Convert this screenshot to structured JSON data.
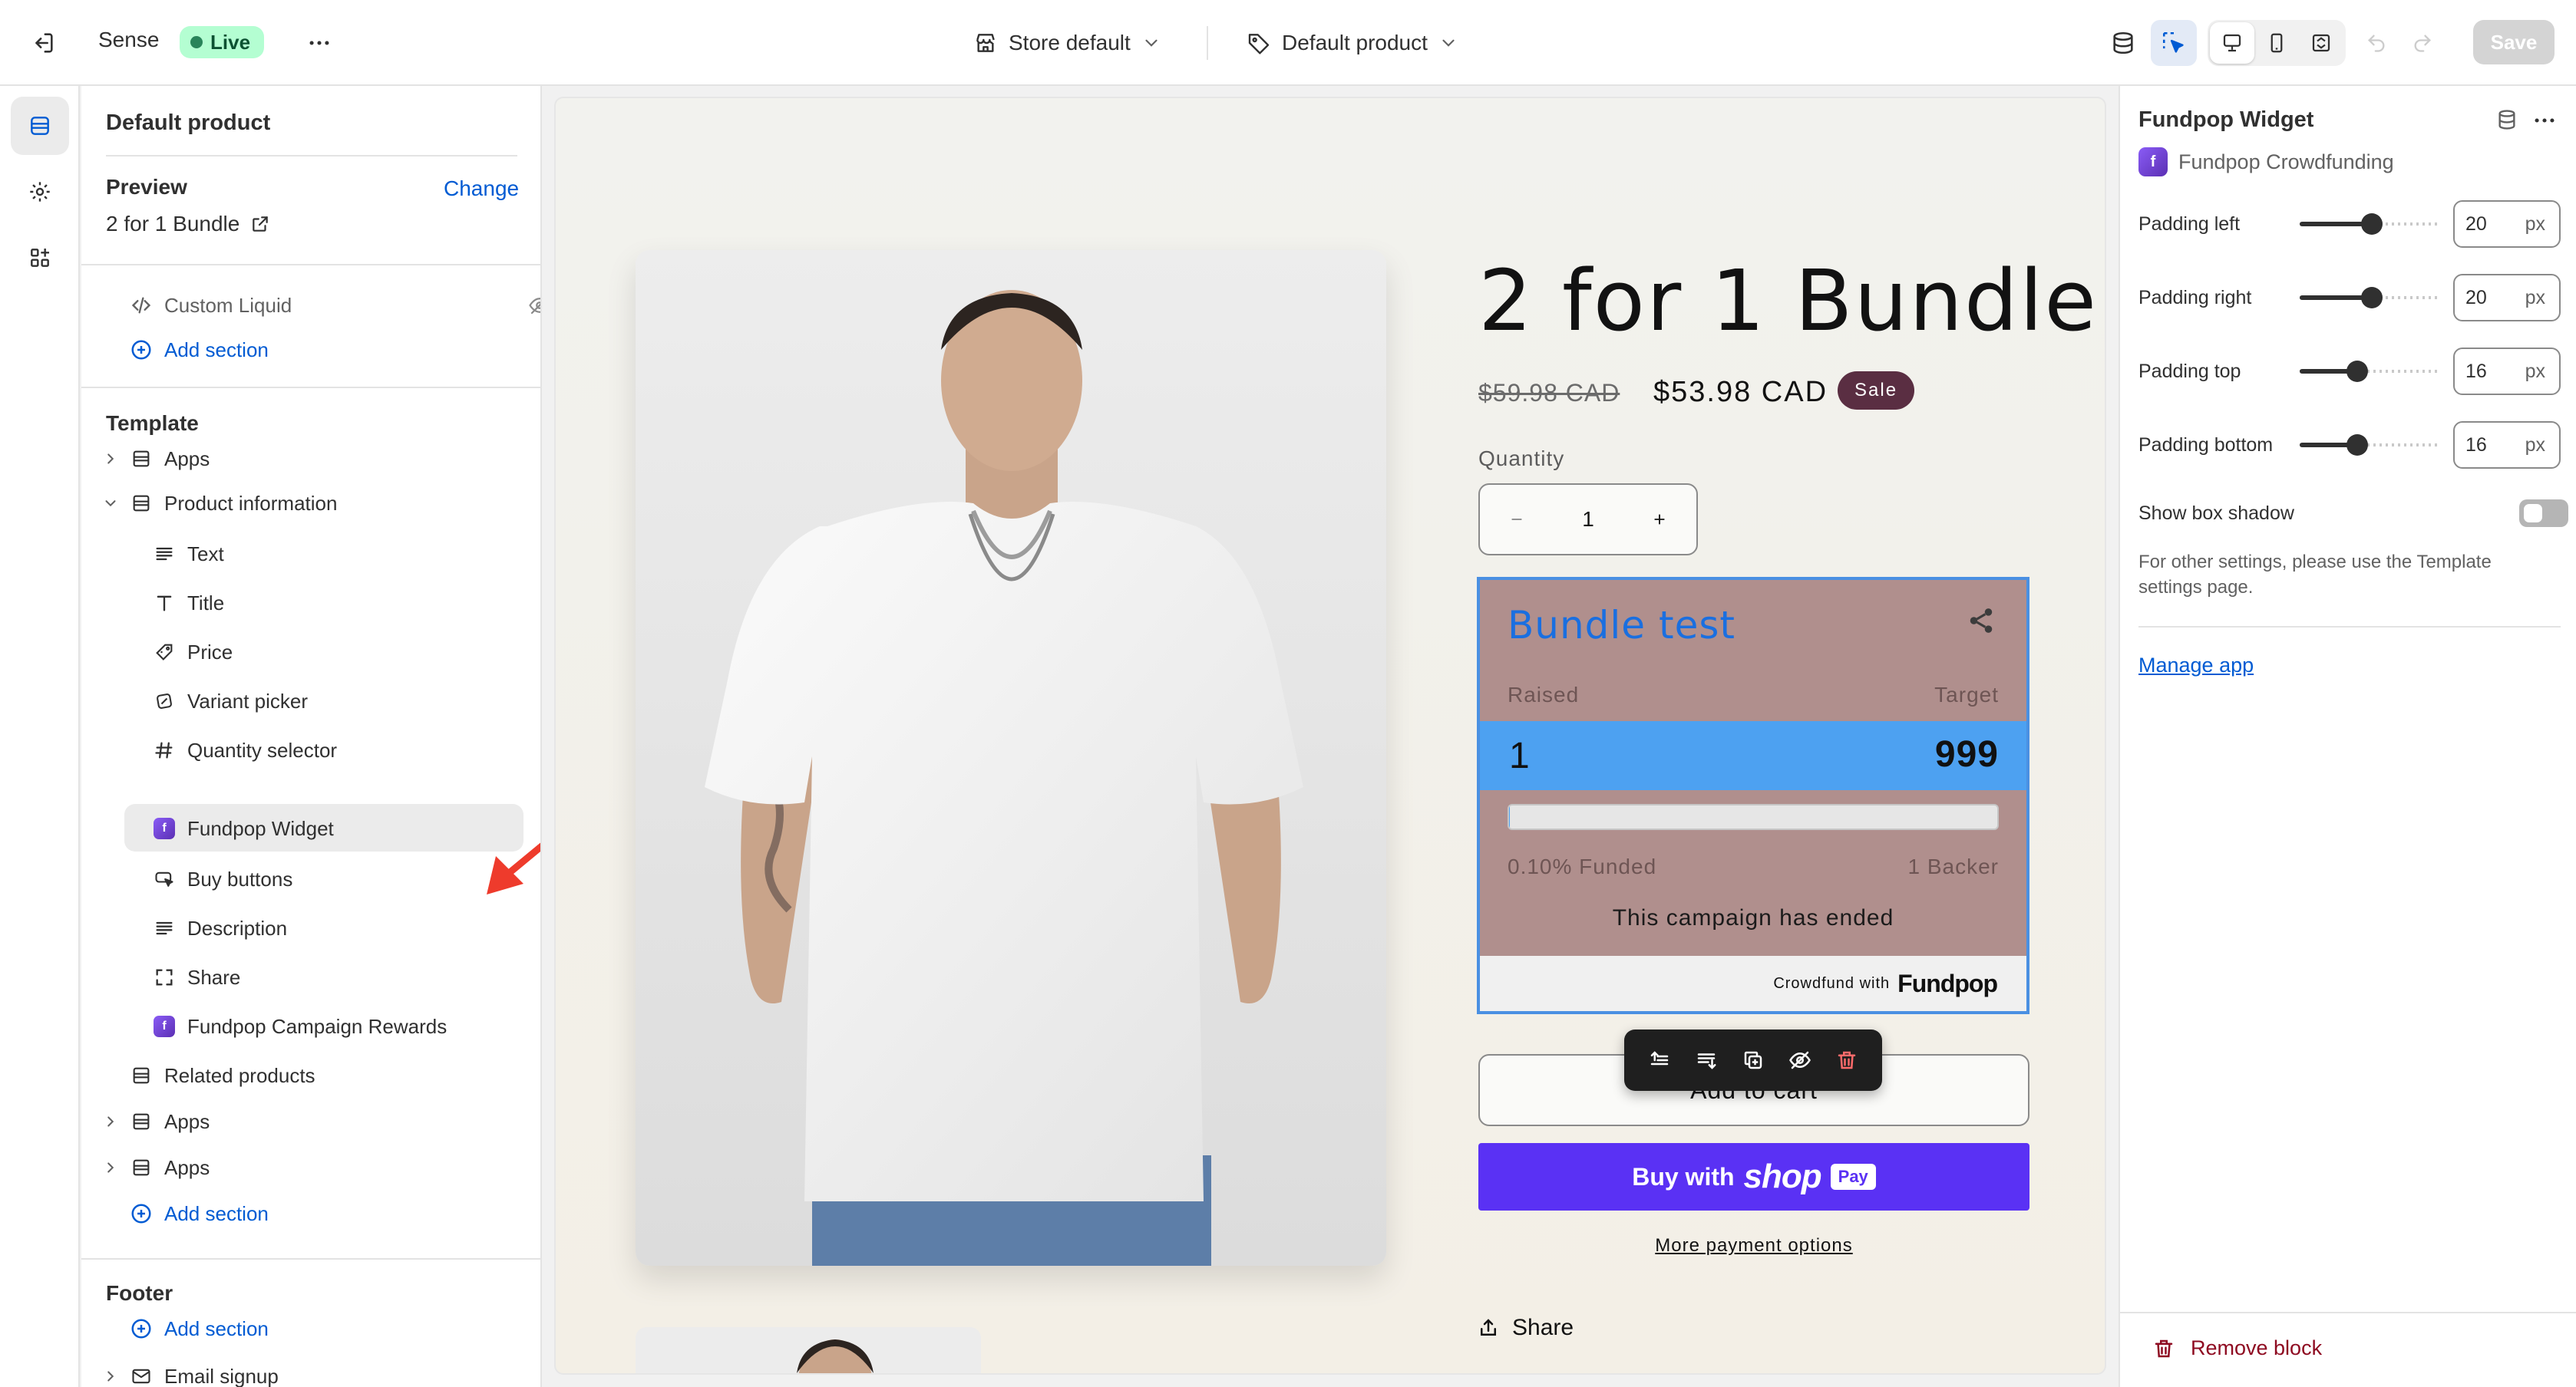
{
  "topbar": {
    "theme_name": "Sense",
    "live_label": "Live",
    "store_selector": "Store default",
    "template_selector": "Default product",
    "save_label": "Save"
  },
  "sidebar": {
    "title": "Default product",
    "preview": {
      "label": "Preview",
      "change_label": "Change",
      "value": "2 for 1 Bundle"
    },
    "header_items": {
      "custom_liquid": "Custom Liquid",
      "add_section": "Add section"
    },
    "template": {
      "label": "Template",
      "apps_1": "Apps",
      "product_information": "Product information",
      "blocks": [
        {
          "label": "Text",
          "icon": "text-icon"
        },
        {
          "label": "Title",
          "icon": "title-icon"
        },
        {
          "label": "Price",
          "icon": "price-tag-icon"
        },
        {
          "label": "Variant picker",
          "icon": "variant-picker-icon"
        },
        {
          "label": "Quantity selector",
          "icon": "hash-icon"
        },
        {
          "label": "Fundpop Widget",
          "icon": "fundpop-app-icon"
        },
        {
          "label": "Buy buttons",
          "icon": "buy-buttons-icon"
        },
        {
          "label": "Description",
          "icon": "text-icon"
        },
        {
          "label": "Share",
          "icon": "share-frame-icon"
        },
        {
          "label": "Fundpop Campaign Rewards",
          "icon": "fundpop-app-icon"
        }
      ],
      "related_products": "Related products",
      "apps_2": "Apps",
      "apps_3": "Apps",
      "add_section": "Add section"
    },
    "footer": {
      "label": "Footer",
      "add_section": "Add section",
      "email_signup": "Email signup"
    }
  },
  "preview": {
    "product_title": "2 for 1 Bundle",
    "compare_price": "$59.98 CAD",
    "price": "$53.98 CAD",
    "sale_badge": "Sale",
    "quantity_label": "Quantity",
    "quantity_value": "1",
    "widget": {
      "title": "Bundle test",
      "raised_label": "Raised",
      "target_label": "Target",
      "raised_value": "1",
      "target_value": "999",
      "progress_fraction": 0.001,
      "funded_label": "0.10% Funded",
      "backer_label": "1 Backer",
      "status_text": "This campaign has ended",
      "footer_prefix": "Crowdfund with",
      "footer_brand": "Fundpop"
    },
    "add_to_cart": "Add to cart",
    "buy_with": "Buy with",
    "shop_word": "shop",
    "pay_word": "Pay",
    "more_payment": "More payment options",
    "share": "Share"
  },
  "settings": {
    "block_title": "Fundpop Widget",
    "app_name": "Fundpop Crowdfunding",
    "sliders": [
      {
        "label": "Padding left",
        "value": "20",
        "unit": "px",
        "fraction": 0.51
      },
      {
        "label": "Padding right",
        "value": "20",
        "unit": "px",
        "fraction": 0.51
      },
      {
        "label": "Padding top",
        "value": "16",
        "unit": "px",
        "fraction": 0.41
      },
      {
        "label": "Padding bottom",
        "value": "16",
        "unit": "px",
        "fraction": 0.41
      }
    ],
    "show_box_shadow_label": "Show box shadow",
    "show_box_shadow": false,
    "note": "For other settings, please use the Template settings page.",
    "manage_app": "Manage app",
    "remove_block": "Remove block"
  },
  "colors": {
    "accent_link": "#005bd3",
    "live_badge_bg": "#b4fed2",
    "widget_bg": "#b08f8d",
    "widget_band": "#4da1f1",
    "widget_title": "#1a6fe0",
    "shop_pay": "#5a31f4",
    "sale_badge": "#5a2e42",
    "danger": "#8e0b21"
  }
}
